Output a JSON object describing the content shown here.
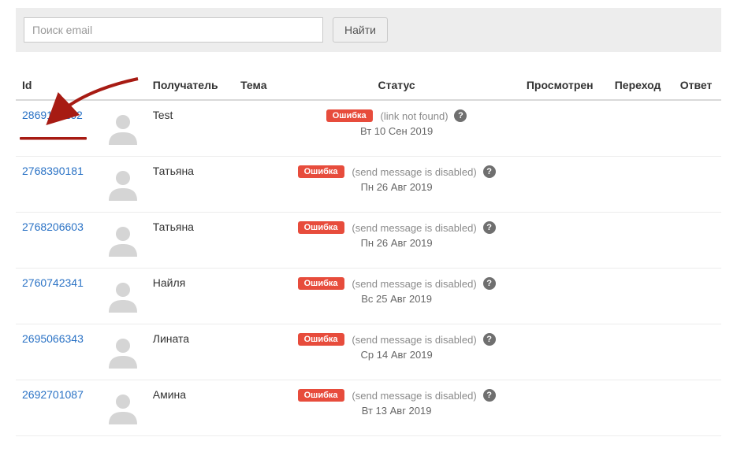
{
  "search": {
    "placeholder": "Поиск email",
    "button": "Найти"
  },
  "columns": {
    "id": "Id",
    "recipient": "Получатель",
    "subject": "Тема",
    "status": "Статус",
    "viewed": "Просмотрен",
    "click": "Переход",
    "reply": "Ответ"
  },
  "error_label": "Ошибка",
  "rows": [
    {
      "id": "2869101162",
      "recipient": "Test",
      "status_msg": "(link not found)",
      "date": "Вт 10 Сен 2019"
    },
    {
      "id": "2768390181",
      "recipient": "Татьяна",
      "status_msg": "(send message is disabled)",
      "date": "Пн 26 Авг 2019"
    },
    {
      "id": "2768206603",
      "recipient": "Татьяна",
      "status_msg": "(send message is disabled)",
      "date": "Пн 26 Авг 2019"
    },
    {
      "id": "2760742341",
      "recipient": "Найля",
      "status_msg": "(send message is disabled)",
      "date": "Вс 25 Авг 2019"
    },
    {
      "id": "2695066343",
      "recipient": "Лината",
      "status_msg": "(send message is disabled)",
      "date": "Ср 14 Авг 2019"
    },
    {
      "id": "2692701087",
      "recipient": "Амина",
      "status_msg": "(send message is disabled)",
      "date": "Вт 13 Авг 2019"
    }
  ]
}
